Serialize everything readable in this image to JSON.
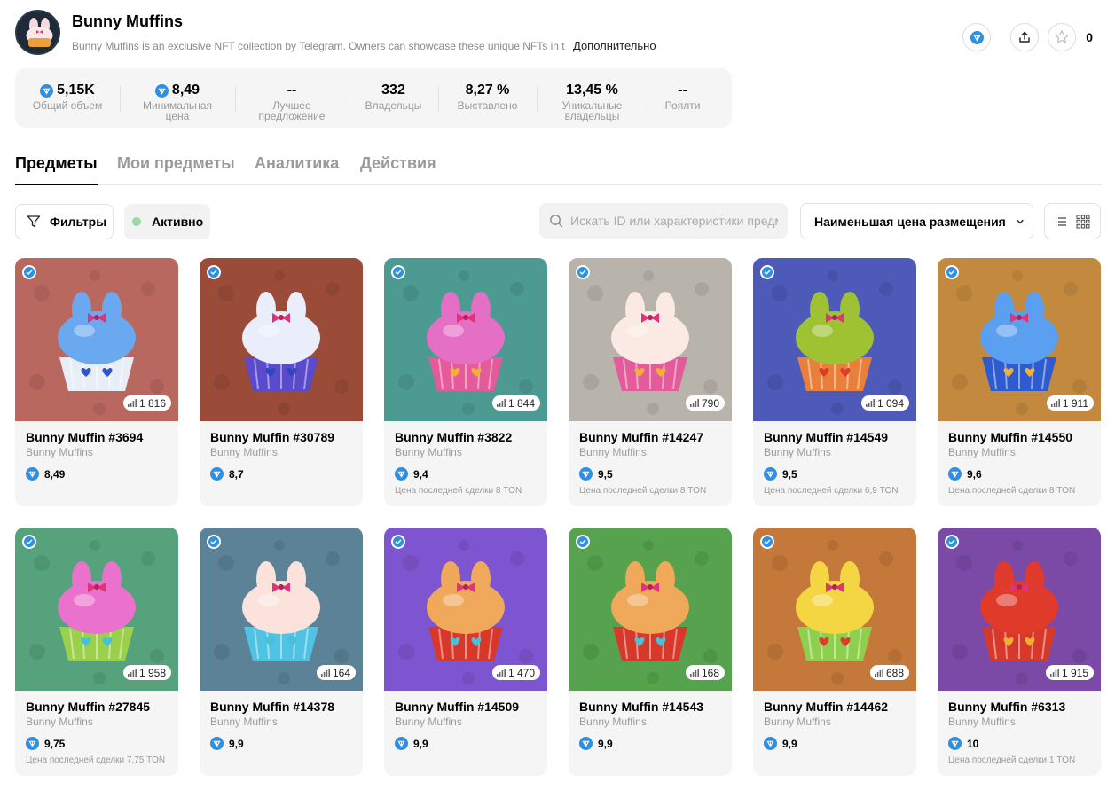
{
  "collection": {
    "title": "Bunny Muffins",
    "description": "Bunny Muffins is an exclusive NFT collection by Telegram. Owners can showcase these unique NFTs in their profiles",
    "more_label": "Дополнительно",
    "star_count": "0"
  },
  "stats": [
    {
      "value": "5,15K",
      "label": "Общий объем",
      "ton": true
    },
    {
      "value": "8,49",
      "label": "Минимальная цена",
      "ton": true
    },
    {
      "value": "--",
      "label": "Лучшее предложение",
      "ton": false
    },
    {
      "value": "332",
      "label": "Владельцы",
      "ton": false
    },
    {
      "value": "8,27 %",
      "label": "Выставлено",
      "ton": false
    },
    {
      "value": "13,45 %",
      "label": "Уникальные владельцы",
      "ton": false
    },
    {
      "value": "--",
      "label": "Роялти",
      "ton": false
    }
  ],
  "tabs": [
    "Предметы",
    "Мои предметы",
    "Аналитика",
    "Действия"
  ],
  "toolbar": {
    "filters_label": "Фильтры",
    "active_label": "Активно",
    "search_placeholder": "Искать ID или характеристики предметов",
    "sort_label": "Наименьшая цена размещения"
  },
  "items": [
    {
      "name": "Bunny Muffin #3694",
      "collection": "Bunny Muffins",
      "price": "8,49",
      "last": "",
      "count": "1 816",
      "bg": "#b9685f",
      "frost": "#6aa9f0",
      "cup": "#e8eef8",
      "heart": "#2e56c8"
    },
    {
      "name": "Bunny Muffin #30789",
      "collection": "Bunny Muffins",
      "price": "8,7",
      "last": "",
      "count": "",
      "bg": "#9a4c38",
      "frost": "#e9eefa",
      "cup": "#5b4acb",
      "heart": "#2c47c2"
    },
    {
      "name": "Bunny Muffin #3822",
      "collection": "Bunny Muffins",
      "price": "9,4",
      "last": "Цена последней сделки 8 TON",
      "count": "1 844",
      "bg": "#4c9a92",
      "frost": "#e56fc4",
      "cup": "#e55a9a",
      "heart": "#f0b030"
    },
    {
      "name": "Bunny Muffin #14247",
      "collection": "Bunny Muffins",
      "price": "9,5",
      "last": "Цена последней сделки 8 TON",
      "count": "790",
      "bg": "#b8b4ac",
      "frost": "#fbe9e4",
      "cup": "#e45b9c",
      "heart": "#f0b030"
    },
    {
      "name": "Bunny Muffin #14549",
      "collection": "Bunny Muffins",
      "price": "9,5",
      "last": "Цена последней сделки 6,9 TON",
      "count": "1 094",
      "bg": "#4d5ab8",
      "frost": "#9fc232",
      "cup": "#e9803a",
      "heart": "#e03a2a"
    },
    {
      "name": "Bunny Muffin #14550",
      "collection": "Bunny Muffins",
      "price": "9,6",
      "last": "Цена последней сделки 8 TON",
      "count": "1 911",
      "bg": "#c38a3f",
      "frost": "#5b9ff0",
      "cup": "#2e5bd0",
      "heart": "#f0b030"
    },
    {
      "name": "Bunny Muffin #27845",
      "collection": "Bunny Muffins",
      "price": "9,75",
      "last": "Цена последней сделки 7,75 TON",
      "count": "1 958",
      "bg": "#55a27c",
      "frost": "#ea72cc",
      "cup": "#9ad04a",
      "heart": "#4ac0d8"
    },
    {
      "name": "Bunny Muffin #14378",
      "collection": "Bunny Muffins",
      "price": "9,9",
      "last": "",
      "count": "164",
      "bg": "#5b8296",
      "frost": "#fbe3dc",
      "cup": "#4fc3e3",
      "heart": "#4ac0d8"
    },
    {
      "name": "Bunny Muffin #14509",
      "collection": "Bunny Muffins",
      "price": "9,9",
      "last": "",
      "count": "1 470",
      "bg": "#7d55d0",
      "frost": "#f0a85a",
      "cup": "#d8382a",
      "heart": "#4ac0d8"
    },
    {
      "name": "Bunny Muffin #14543",
      "collection": "Bunny Muffins",
      "price": "9,9",
      "last": "",
      "count": "168",
      "bg": "#56a24e",
      "frost": "#f0a85a",
      "cup": "#d8382a",
      "heart": "#4ac0d8"
    },
    {
      "name": "Bunny Muffin #14462",
      "collection": "Bunny Muffins",
      "price": "9,9",
      "last": "",
      "count": "688",
      "bg": "#c4783a",
      "frost": "#f3d642",
      "cup": "#8ed04e",
      "heart": "#e03a2a"
    },
    {
      "name": "Bunny Muffin #6313",
      "collection": "Bunny Muffins",
      "price": "10",
      "last": "Цена последней сделки 1 TON",
      "count": "1 915",
      "bg": "#7a4aa6",
      "frost": "#e03a2a",
      "cup": "#d8382a",
      "heart": "#f0b030"
    }
  ]
}
